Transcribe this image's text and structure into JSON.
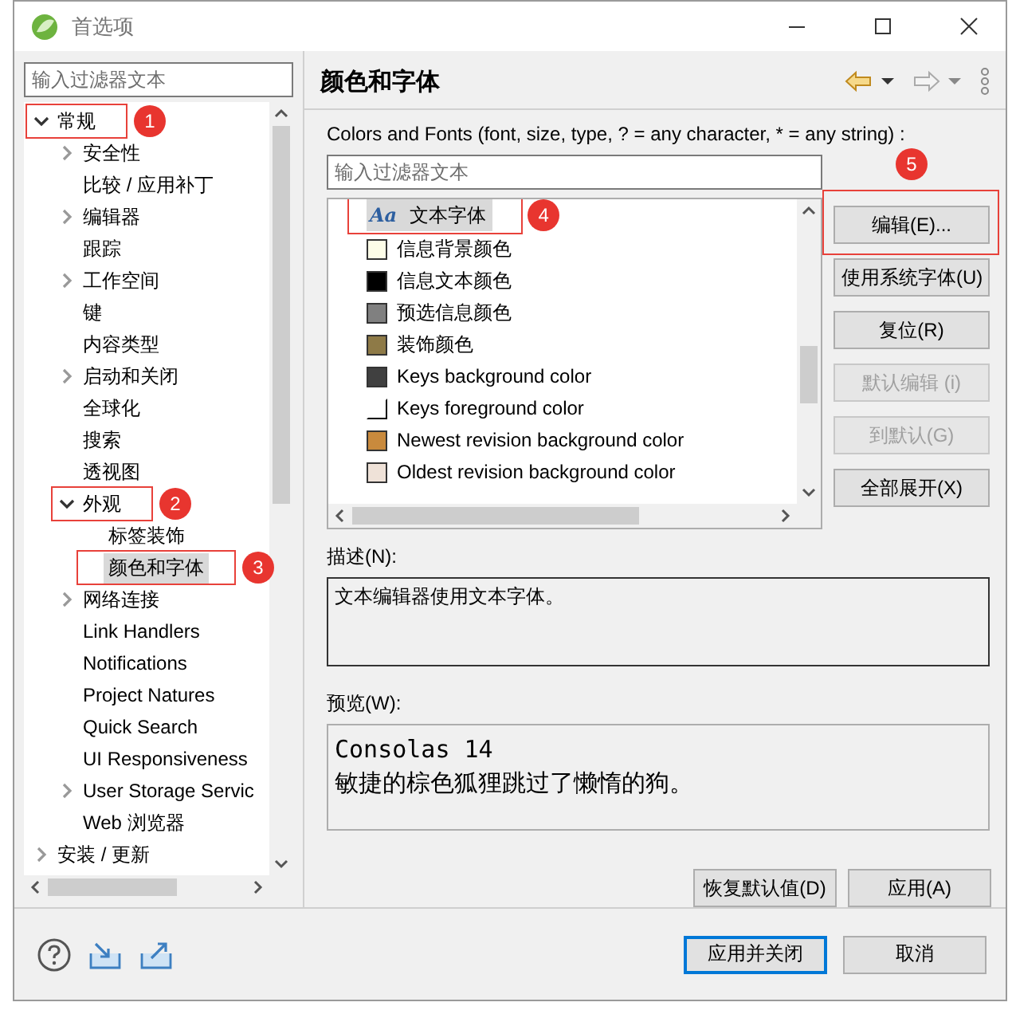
{
  "window": {
    "title": "首选项"
  },
  "sidebar": {
    "filter": {
      "placeholder": "输入过滤器文本"
    },
    "tree": [
      {
        "label": "常规",
        "expanded": true,
        "selected": false,
        "callout": "1",
        "children": [
          {
            "label": "安全性",
            "expanded": false,
            "selected": false
          },
          {
            "label": "比较 / 应用补丁",
            "selected": false
          },
          {
            "label": "编辑器",
            "expanded": false,
            "selected": false
          },
          {
            "label": "跟踪",
            "selected": false
          },
          {
            "label": "工作空间",
            "expanded": false,
            "selected": false
          },
          {
            "label": "键",
            "selected": false
          },
          {
            "label": "内容类型",
            "selected": false
          },
          {
            "label": "启动和关闭",
            "expanded": false,
            "selected": false
          },
          {
            "label": "全球化",
            "selected": false
          },
          {
            "label": "搜索",
            "selected": false
          },
          {
            "label": "透视图",
            "selected": false
          },
          {
            "label": "外观",
            "expanded": true,
            "selected": false,
            "callout": "2",
            "children": [
              {
                "label": "标签装饰",
                "selected": false
              },
              {
                "label": "颜色和字体",
                "selected": true,
                "callout": "3"
              }
            ]
          },
          {
            "label": "网络连接",
            "expanded": false,
            "selected": false
          },
          {
            "label": "Link Handlers",
            "selected": false
          },
          {
            "label": "Notifications",
            "selected": false
          },
          {
            "label": "Project Natures",
            "selected": false
          },
          {
            "label": "Quick Search",
            "selected": false
          },
          {
            "label": "UI Responsiveness",
            "selected": false
          },
          {
            "label": "User Storage Servic",
            "expanded": false,
            "selected": false
          },
          {
            "label": "Web 浏览器",
            "selected": false
          }
        ]
      },
      {
        "label": "安装 / 更新",
        "expanded": false,
        "selected": false
      }
    ]
  },
  "page": {
    "title": "颜色和字体",
    "label": "Colors and Fonts (font, size, type, ? = any character, * = any string) :",
    "filter": {
      "placeholder": "输入过滤器文本"
    },
    "items": [
      {
        "kind": "font",
        "glyph": "Aa",
        "label": "文本字体",
        "selected": true,
        "callout": "4"
      },
      {
        "kind": "color",
        "label": "信息背景颜色",
        "color": "#fdfde8",
        "selected": false
      },
      {
        "kind": "color",
        "label": "信息文本颜色",
        "color": "#000000",
        "selected": false
      },
      {
        "kind": "color",
        "label": "预选信息颜色",
        "color": "#808080",
        "selected": false
      },
      {
        "kind": "color",
        "label": "装饰颜色",
        "color": "#8e7a47",
        "selected": false
      },
      {
        "kind": "color",
        "label": "Keys background color",
        "color": "#404040",
        "selected": false
      },
      {
        "kind": "color",
        "label": "Keys foreground color",
        "color": "#ffffff",
        "selected": false
      },
      {
        "kind": "color",
        "label": "Newest revision background color",
        "color": "#c98a3d",
        "selected": false
      },
      {
        "kind": "color",
        "label": "Oldest revision background color",
        "color": "#efe2d8",
        "selected": false
      }
    ],
    "side_buttons": [
      {
        "label": "编辑(E)...",
        "disabled": false,
        "callout": "5"
      },
      {
        "label": "使用系统字体(U)",
        "disabled": false
      },
      {
        "label": "复位(R)",
        "disabled": false
      },
      {
        "label": "默认编辑 (i)",
        "disabled": true
      },
      {
        "label": "到默认(G)",
        "disabled": true
      },
      {
        "label": "全部展开(X)",
        "disabled": false
      }
    ],
    "description": {
      "label": "描述(N):",
      "text": "文本编辑器使用文本字体。"
    },
    "preview": {
      "label": "预览(W):",
      "lines": [
        "Consolas 14",
        "敏捷的棕色狐狸跳过了懒惰的狗。"
      ]
    },
    "buttons": [
      "恢复默认值(D)",
      "应用(A)"
    ]
  },
  "footer": {
    "buttons": [
      {
        "label": "应用并关闭",
        "default": true
      },
      {
        "label": "取消",
        "default": false
      }
    ]
  }
}
